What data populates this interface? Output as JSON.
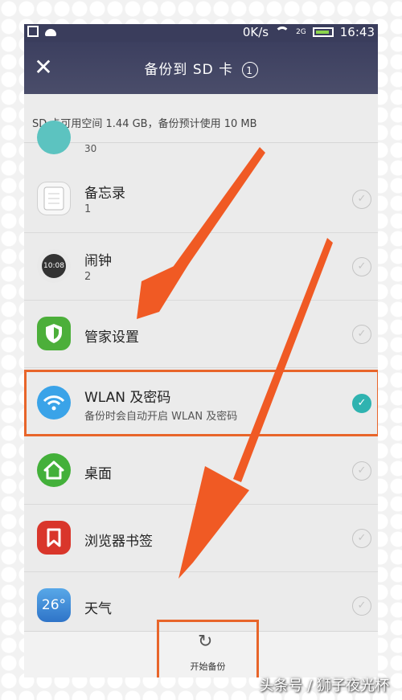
{
  "status_bar": {
    "speed": "0K/s",
    "network": "2G",
    "time": "16:43"
  },
  "header": {
    "title": "备份到 SD 卡",
    "badge": "1"
  },
  "info": {
    "text": "SD 卡可用空间 1.44 GB，备份预计使用 10 MB"
  },
  "list": {
    "partial_sub": "30",
    "items": [
      {
        "title": "备忘录",
        "sub": "1",
        "icon": "notepad-icon",
        "icon_color": "#f5f5f5",
        "checked": false
      },
      {
        "title": "闹钟",
        "sub": "2",
        "icon": "clock-icon",
        "icon_text": "10:08",
        "icon_color": "#e9e9e9",
        "checked": false
      },
      {
        "title": "管家设置",
        "sub": "",
        "icon": "shield-icon",
        "icon_color": "#4caf3a",
        "checked": false
      },
      {
        "title": "WLAN 及密码",
        "sub": "备份时会自动开启 WLAN 及密码",
        "icon": "wifi-icon",
        "icon_color": "#3aa3e8",
        "checked": true
      },
      {
        "title": "桌面",
        "sub": "",
        "icon": "home-icon",
        "icon_color": "#43b03a",
        "checked": false
      },
      {
        "title": "浏览器书签",
        "sub": "",
        "icon": "bookmark-icon",
        "icon_color": "#d9362b",
        "checked": false
      },
      {
        "title": "天气",
        "sub": "",
        "icon": "weather-icon",
        "icon_text": "26°",
        "icon_color": "#3b8fd9",
        "checked": false
      }
    ]
  },
  "bottom": {
    "start_label": "开始备份",
    "icon": "refresh-icon"
  },
  "watermark": "头条号 / 狮子夜光杯",
  "colors": {
    "header": "#3c3f5f",
    "accent": "#2fb3b0",
    "annotation": "#f05a24"
  }
}
